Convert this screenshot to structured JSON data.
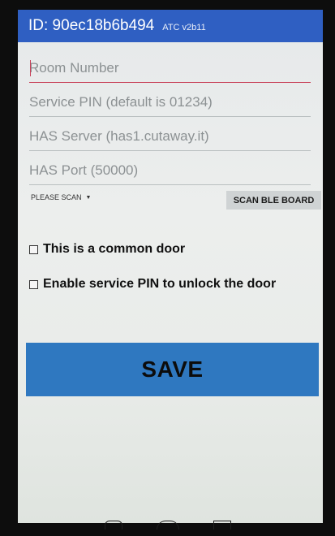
{
  "titlebar": {
    "id_text": "ID: 90ec18b6b494",
    "version": "ATC v2b11"
  },
  "fields": {
    "room_number": {
      "placeholder": "Room Number",
      "value": ""
    },
    "service_pin": {
      "placeholder": "Service PIN (default is 01234)",
      "value": ""
    },
    "has_server": {
      "placeholder": "HAS Server (has1.cutaway.it)",
      "value": ""
    },
    "has_port": {
      "placeholder": "HAS Port (50000)",
      "value": ""
    }
  },
  "board_selector": {
    "selected": "PLEASE SCAN"
  },
  "scan_button": {
    "label": "SCAN BLE BOARD"
  },
  "checkboxes": {
    "common_door": {
      "label": "This is a common door",
      "checked": false
    },
    "service_pin_unlock": {
      "label": "Enable service PIN to unlock the door",
      "checked": false
    }
  },
  "save_button": {
    "label": "SAVE"
  },
  "colors": {
    "titlebar": "#2f5fc2",
    "save_button": "#2f78c0",
    "focus_underline": "#c8425a"
  },
  "icons": [
    "chevron-down-icon",
    "checkbox-icon",
    "back-icon",
    "home-icon",
    "recent-apps-icon"
  ]
}
